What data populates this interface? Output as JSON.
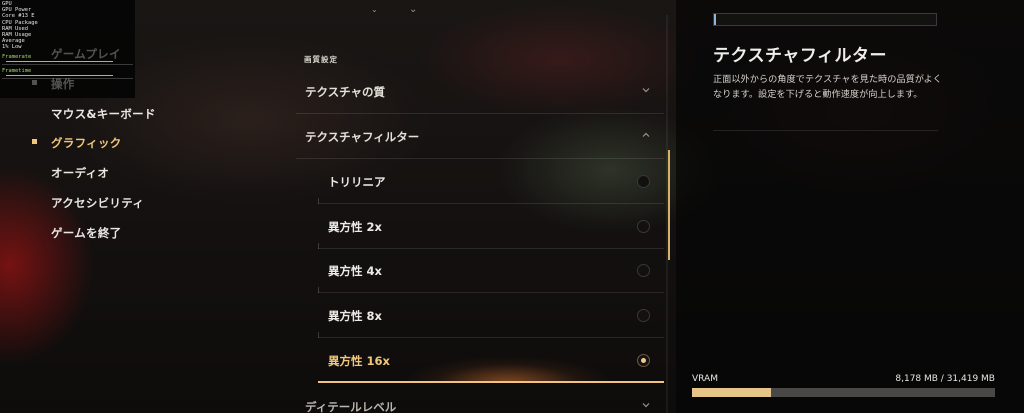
{
  "overlay": {
    "rows": [
      {
        "label": "GPU",
        "value": "",
        "extra": ""
      },
      {
        "label": "GPU Power",
        "value": "",
        "extra": ""
      },
      {
        "label": "Core #13 E",
        "value": "",
        "extra": ""
      },
      {
        "label": "CPU Package",
        "value": "",
        "extra": ""
      },
      {
        "label": "RAM Used",
        "value": "",
        "extra": ""
      },
      {
        "label": "RAM Usage",
        "value": "",
        "extra": ""
      },
      {
        "label": "Average",
        "value": "",
        "extra": ""
      },
      {
        "label": "1% Low",
        "value": "",
        "extra": ""
      }
    ],
    "graph1_label": "Framerate",
    "graph1_value": "",
    "graph2_label": "Frametime",
    "graph2_value": ""
  },
  "left_menu": {
    "items": [
      {
        "label": "ゲームプレイ",
        "state": "dim"
      },
      {
        "label": "操作",
        "state": "dim"
      },
      {
        "label": "マウス&キーボード",
        "state": "normal"
      },
      {
        "label": "グラフィック",
        "state": "active"
      },
      {
        "label": "オーディオ",
        "state": "normal"
      },
      {
        "label": "アクセシビリティ",
        "state": "normal"
      },
      {
        "label": "ゲームを終了",
        "state": "normal"
      }
    ]
  },
  "center": {
    "section_title": "画質設定",
    "rows": [
      {
        "label": "テクスチャの質",
        "expanded": false
      },
      {
        "label": "テクスチャフィルター",
        "expanded": true
      }
    ],
    "options": [
      {
        "label": "トリリニア",
        "selected": false
      },
      {
        "label": "異方性 2x",
        "selected": false
      },
      {
        "label": "異方性 4x",
        "selected": false
      },
      {
        "label": "異方性 8x",
        "selected": false
      },
      {
        "label": "異方性 16x",
        "selected": true
      }
    ],
    "bottom_row": {
      "label": "ディテールレベル",
      "expanded": false
    }
  },
  "right_panel": {
    "title": "テクスチャフィルター",
    "description": "正面以外からの角度でテクスチャを見た時の品質がよくなります。設定を下げると動作速度が向上します。",
    "vram": {
      "label": "VRAM",
      "value": "8,178 MB / 31,419 MB",
      "fraction": 0.26
    }
  },
  "colors": {
    "accent": "#f2c77a",
    "vram_fill": "#e7c488",
    "vram_track": "#4a4846"
  }
}
